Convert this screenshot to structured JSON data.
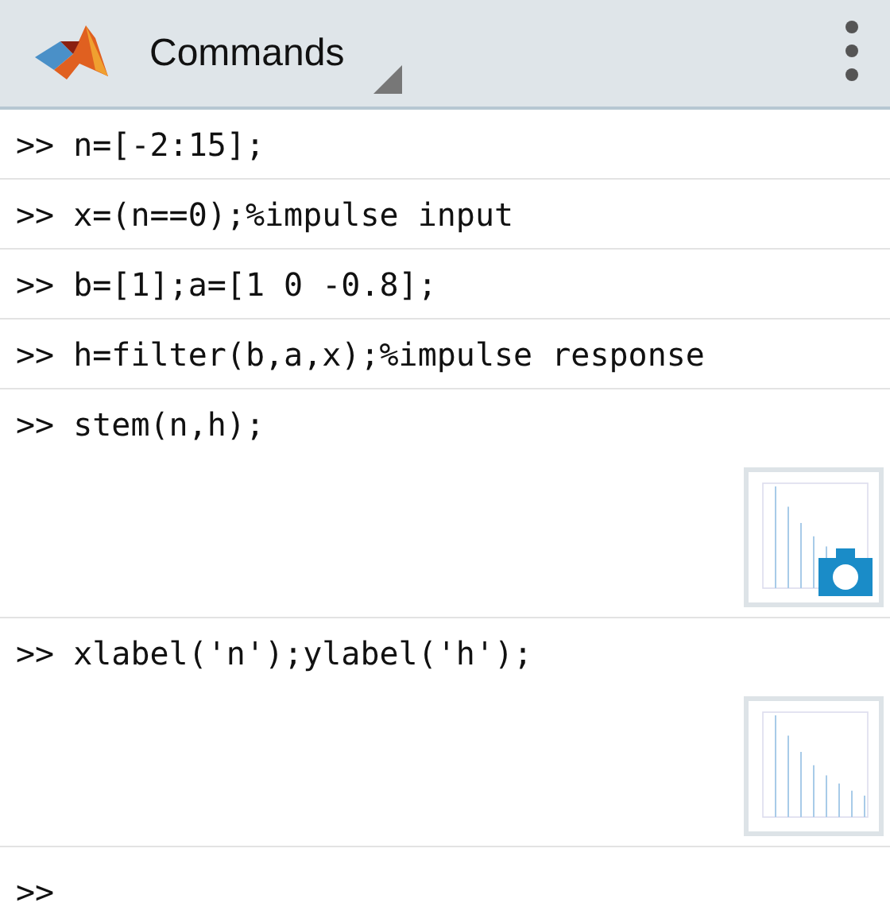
{
  "header": {
    "title": "Commands"
  },
  "commands": [
    {
      "prompt": ">>",
      "code": "n=[-2:15];",
      "has_figure": false,
      "camera": false
    },
    {
      "prompt": ">>",
      "code": "x=(n==0);%impulse input",
      "has_figure": false,
      "camera": false
    },
    {
      "prompt": ">>",
      "code": "b=[1];a=[1 0 -0.8];",
      "has_figure": false,
      "camera": false
    },
    {
      "prompt": ">>",
      "code": "h=filter(b,a,x);%impulse response",
      "has_figure": false,
      "camera": false
    },
    {
      "prompt": ">>",
      "code": "stem(n,h);",
      "has_figure": true,
      "camera": true
    },
    {
      "prompt": ">>",
      "code": "xlabel('n');ylabel('h');",
      "has_figure": true,
      "camera": false
    }
  ],
  "input_prompt": ">>"
}
